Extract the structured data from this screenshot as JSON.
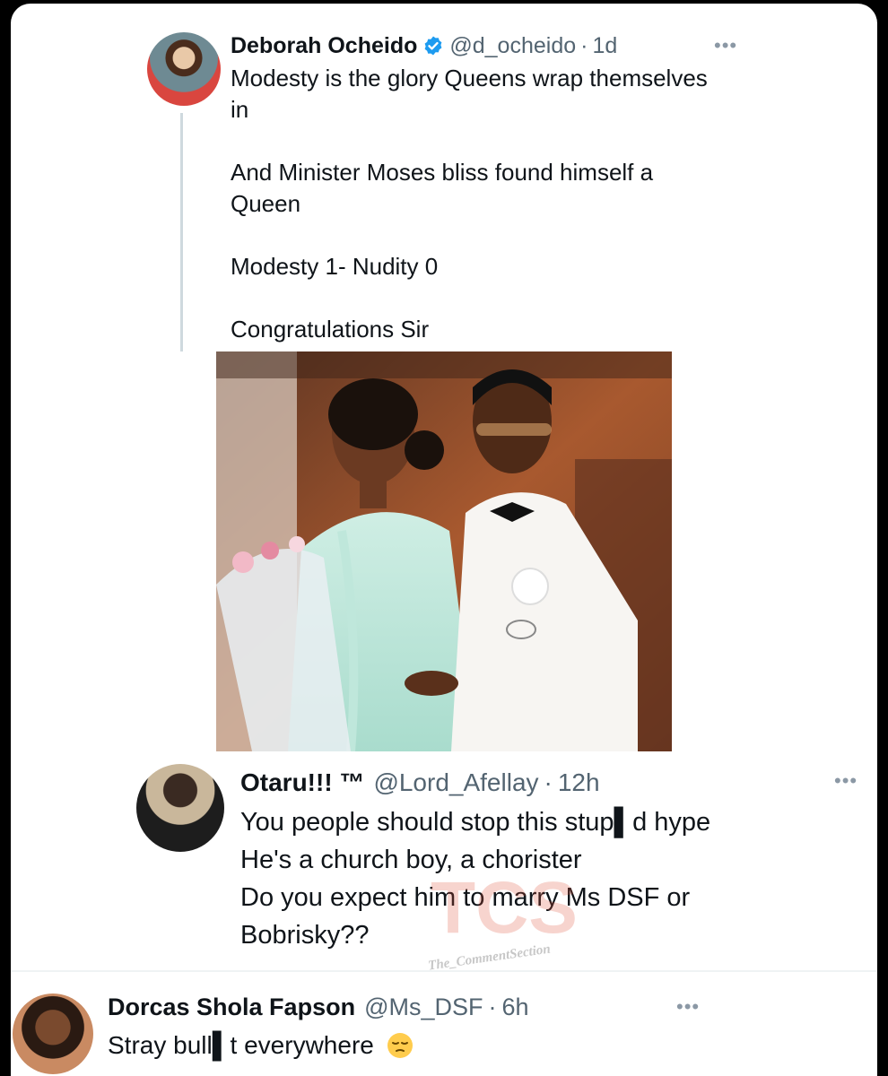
{
  "tweet1": {
    "author_name": "Deborah Ocheido",
    "handle": "@d_ocheido",
    "separator": "·",
    "time": "1d",
    "text": "Modesty is the glory Queens wrap themselves\nin\n\nAnd Minister Moses bliss found himself a\nQueen\n\nModesty 1- Nudity 0\n\nCongratulations Sir",
    "verified_color": "#1d9bf0"
  },
  "tweet2": {
    "author_name": "Otaru!!! ™",
    "handle": "@Lord_Afellay",
    "separator": "·",
    "time": "12h",
    "text": "You people should stop this stup▌d hype\nHe's a church boy, a chorister\nDo you expect him to marry Ms DSF or\nBobrisky??"
  },
  "watermark": {
    "logo_text": "TCS",
    "caption": "The_CommentSection"
  },
  "tweet3": {
    "author_name": "Dorcas Shola Fapson",
    "handle": "@Ms_DSF",
    "separator": "·",
    "time": "6h",
    "text": "Stray bull▌t everywhere",
    "emoji": "pensive-face-emoji"
  },
  "more_label": "•••",
  "colors": {
    "text_primary": "#0f1419",
    "text_secondary": "#536471",
    "verified": "#1d9bf0",
    "watermark": "#e0523a"
  }
}
